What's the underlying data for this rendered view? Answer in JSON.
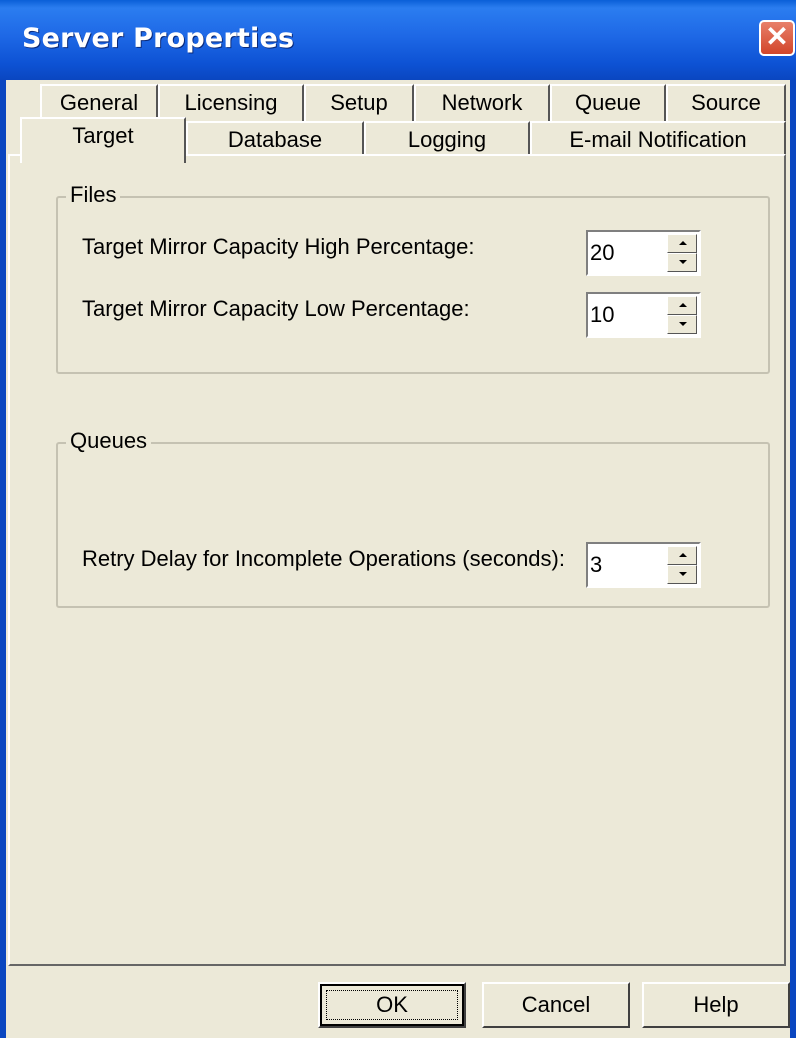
{
  "window": {
    "title": "Server Properties",
    "close_glyph": "✕"
  },
  "tabs": {
    "row1": [
      {
        "label": "General"
      },
      {
        "label": "Licensing"
      },
      {
        "label": "Setup"
      },
      {
        "label": "Network"
      },
      {
        "label": "Queue"
      },
      {
        "label": "Source"
      }
    ],
    "row2": [
      {
        "label": "Target",
        "selected": true
      },
      {
        "label": "Database"
      },
      {
        "label": "Logging"
      },
      {
        "label": "E-mail Notification"
      }
    ]
  },
  "files": {
    "title": "Files",
    "high": {
      "label": "Target Mirror Capacity High Percentage:",
      "value": "20"
    },
    "low": {
      "label": "Target Mirror Capacity Low Percentage:",
      "value": "10"
    }
  },
  "queues": {
    "title": "Queues",
    "retry": {
      "label": "Retry Delay for Incomplete Operations (seconds):",
      "value": "3"
    }
  },
  "buttons": {
    "ok": "OK",
    "cancel": "Cancel",
    "help": "Help"
  },
  "icons": {
    "close": "close-icon",
    "spin_up": "spin-up-arrow-icon",
    "spin_down": "spin-down-arrow-icon"
  }
}
